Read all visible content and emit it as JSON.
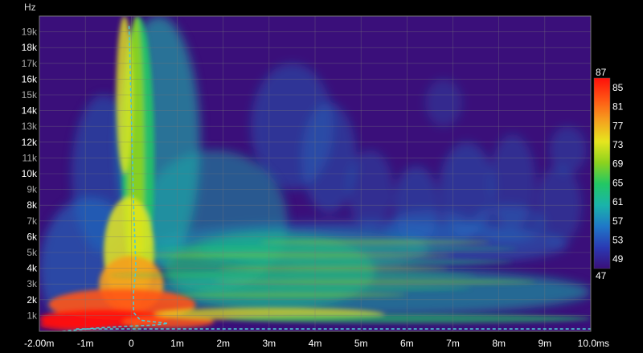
{
  "chart_data": {
    "type": "heatmap",
    "title": "",
    "xlabel": "",
    "ylabel": "",
    "y_unit_label": "Hz",
    "x_range": [
      -2.0,
      10.0
    ],
    "y_range": [
      0,
      20000
    ],
    "x_ticks": [
      {
        "v": -2,
        "label": "-2.00m"
      },
      {
        "v": -1,
        "label": "-1m"
      },
      {
        "v": 0,
        "label": "0"
      },
      {
        "v": 1,
        "label": "1m"
      },
      {
        "v": 2,
        "label": "2m"
      },
      {
        "v": 3,
        "label": "3m"
      },
      {
        "v": 4,
        "label": "4m"
      },
      {
        "v": 5,
        "label": "5m"
      },
      {
        "v": 6,
        "label": "6m"
      },
      {
        "v": 7,
        "label": "7m"
      },
      {
        "v": 8,
        "label": "8m"
      },
      {
        "v": 9,
        "label": "9m"
      },
      {
        "v": 10,
        "label": "10.0ms"
      }
    ],
    "y_ticks": [
      {
        "v": 1000,
        "label": "1k",
        "major": false
      },
      {
        "v": 2000,
        "label": "2k",
        "major": true
      },
      {
        "v": 3000,
        "label": "3k",
        "major": false
      },
      {
        "v": 4000,
        "label": "4k",
        "major": true
      },
      {
        "v": 5000,
        "label": "5k",
        "major": false
      },
      {
        "v": 6000,
        "label": "6k",
        "major": true
      },
      {
        "v": 7000,
        "label": "7k",
        "major": false
      },
      {
        "v": 8000,
        "label": "8k",
        "major": true
      },
      {
        "v": 9000,
        "label": "9k",
        "major": false
      },
      {
        "v": 10000,
        "label": "10k",
        "major": true
      },
      {
        "v": 11000,
        "label": "11k",
        "major": false
      },
      {
        "v": 12000,
        "label": "12k",
        "major": true
      },
      {
        "v": 13000,
        "label": "13k",
        "major": false
      },
      {
        "v": 14000,
        "label": "14k",
        "major": true
      },
      {
        "v": 15000,
        "label": "15k",
        "major": false
      },
      {
        "v": 16000,
        "label": "16k",
        "major": true
      },
      {
        "v": 17000,
        "label": "17k",
        "major": false
      },
      {
        "v": 18000,
        "label": "18k",
        "major": true
      },
      {
        "v": 19000,
        "label": "19k",
        "major": false
      }
    ],
    "colorbar": {
      "min": 47,
      "max": 87,
      "ticks": [
        87,
        85,
        81,
        77,
        73,
        69,
        65,
        61,
        57,
        53,
        49,
        47
      ],
      "colors": [
        "#3a0f7a",
        "#2a3ab4",
        "#1f78c8",
        "#1ab4aa",
        "#22c864",
        "#8cd21e",
        "#e6e61e",
        "#f5a01e",
        "#ff5514",
        "#ff0f0a"
      ]
    },
    "grid": true,
    "legend": "right",
    "ridge_curve": {
      "color": "#4ec8d2",
      "style": "dashed",
      "points": [
        [
          -1.5,
          0
        ],
        [
          -0.8,
          200
        ],
        [
          -0.2,
          300
        ],
        [
          0.5,
          400
        ],
        [
          0.8,
          500
        ],
        [
          0.2,
          700
        ],
        [
          0.05,
          1200
        ],
        [
          0.05,
          2500
        ],
        [
          0.1,
          4000
        ],
        [
          0.05,
          8000
        ],
        [
          0.0,
          14000
        ],
        [
          -0.05,
          19500
        ]
      ]
    },
    "baseline_curve": {
      "color": "#4ec8d2",
      "style": "dashed",
      "points": [
        [
          -1.2,
          150
        ],
        [
          10.0,
          150
        ]
      ]
    }
  }
}
